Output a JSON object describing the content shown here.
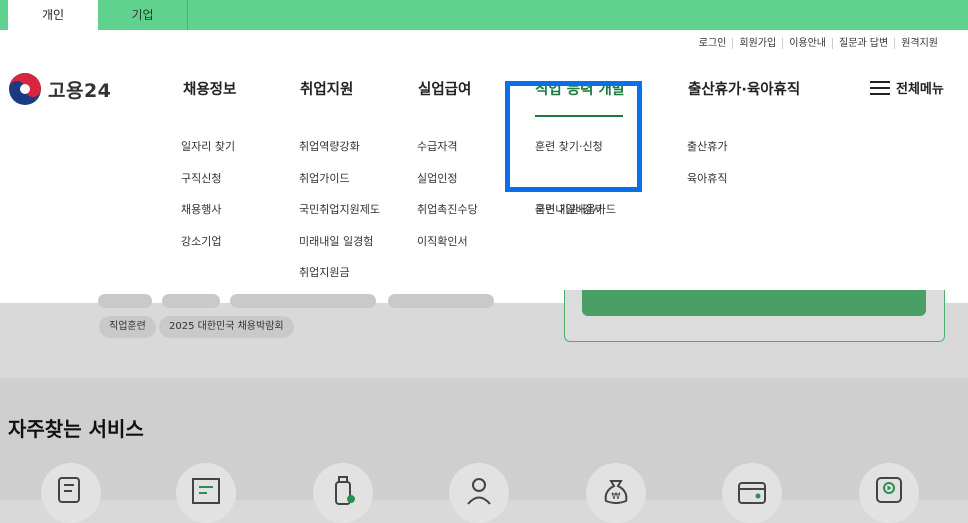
{
  "top_tabs": [
    {
      "label": "개인",
      "active": true
    },
    {
      "label": "기업",
      "active": false
    }
  ],
  "utility_links": [
    "로그인",
    "회원가입",
    "이용안내",
    "질문과 답변",
    "원격지원"
  ],
  "logo": {
    "text": "고용24"
  },
  "gnb": [
    {
      "label": "채용정보",
      "sub": [
        "일자리 찾기",
        "구직신청",
        "채용행사",
        "강소기업"
      ]
    },
    {
      "label": "취업지원",
      "sub": [
        "취업역량강화",
        "취업가이드",
        "국민취업지원제도",
        "미래내일 일경험",
        "취업지원금"
      ]
    },
    {
      "label": "실업급여",
      "sub": [
        "수급자격",
        "실업인정",
        "취업촉진수당",
        "이직확인서"
      ]
    },
    {
      "label": "직업 능력 개발",
      "active": true,
      "sub": [
        "훈련 찾기·신청",
        "국민내일배움카드",
        "훈련 기관·강사"
      ]
    },
    {
      "label": "출산휴가·육아휴직",
      "sub": [
        "출산휴가",
        "육아휴직"
      ]
    }
  ],
  "all_menu_label": "전체메뉴",
  "tags": [
    "직업훈련",
    "2025 대한민국 채용박람회"
  ],
  "section_title": "자주찾는 서비스",
  "colors": {
    "brand_green": "#5fd38d",
    "active_green": "#1a7b3d",
    "highlight_blue": "#0a6fe8"
  }
}
